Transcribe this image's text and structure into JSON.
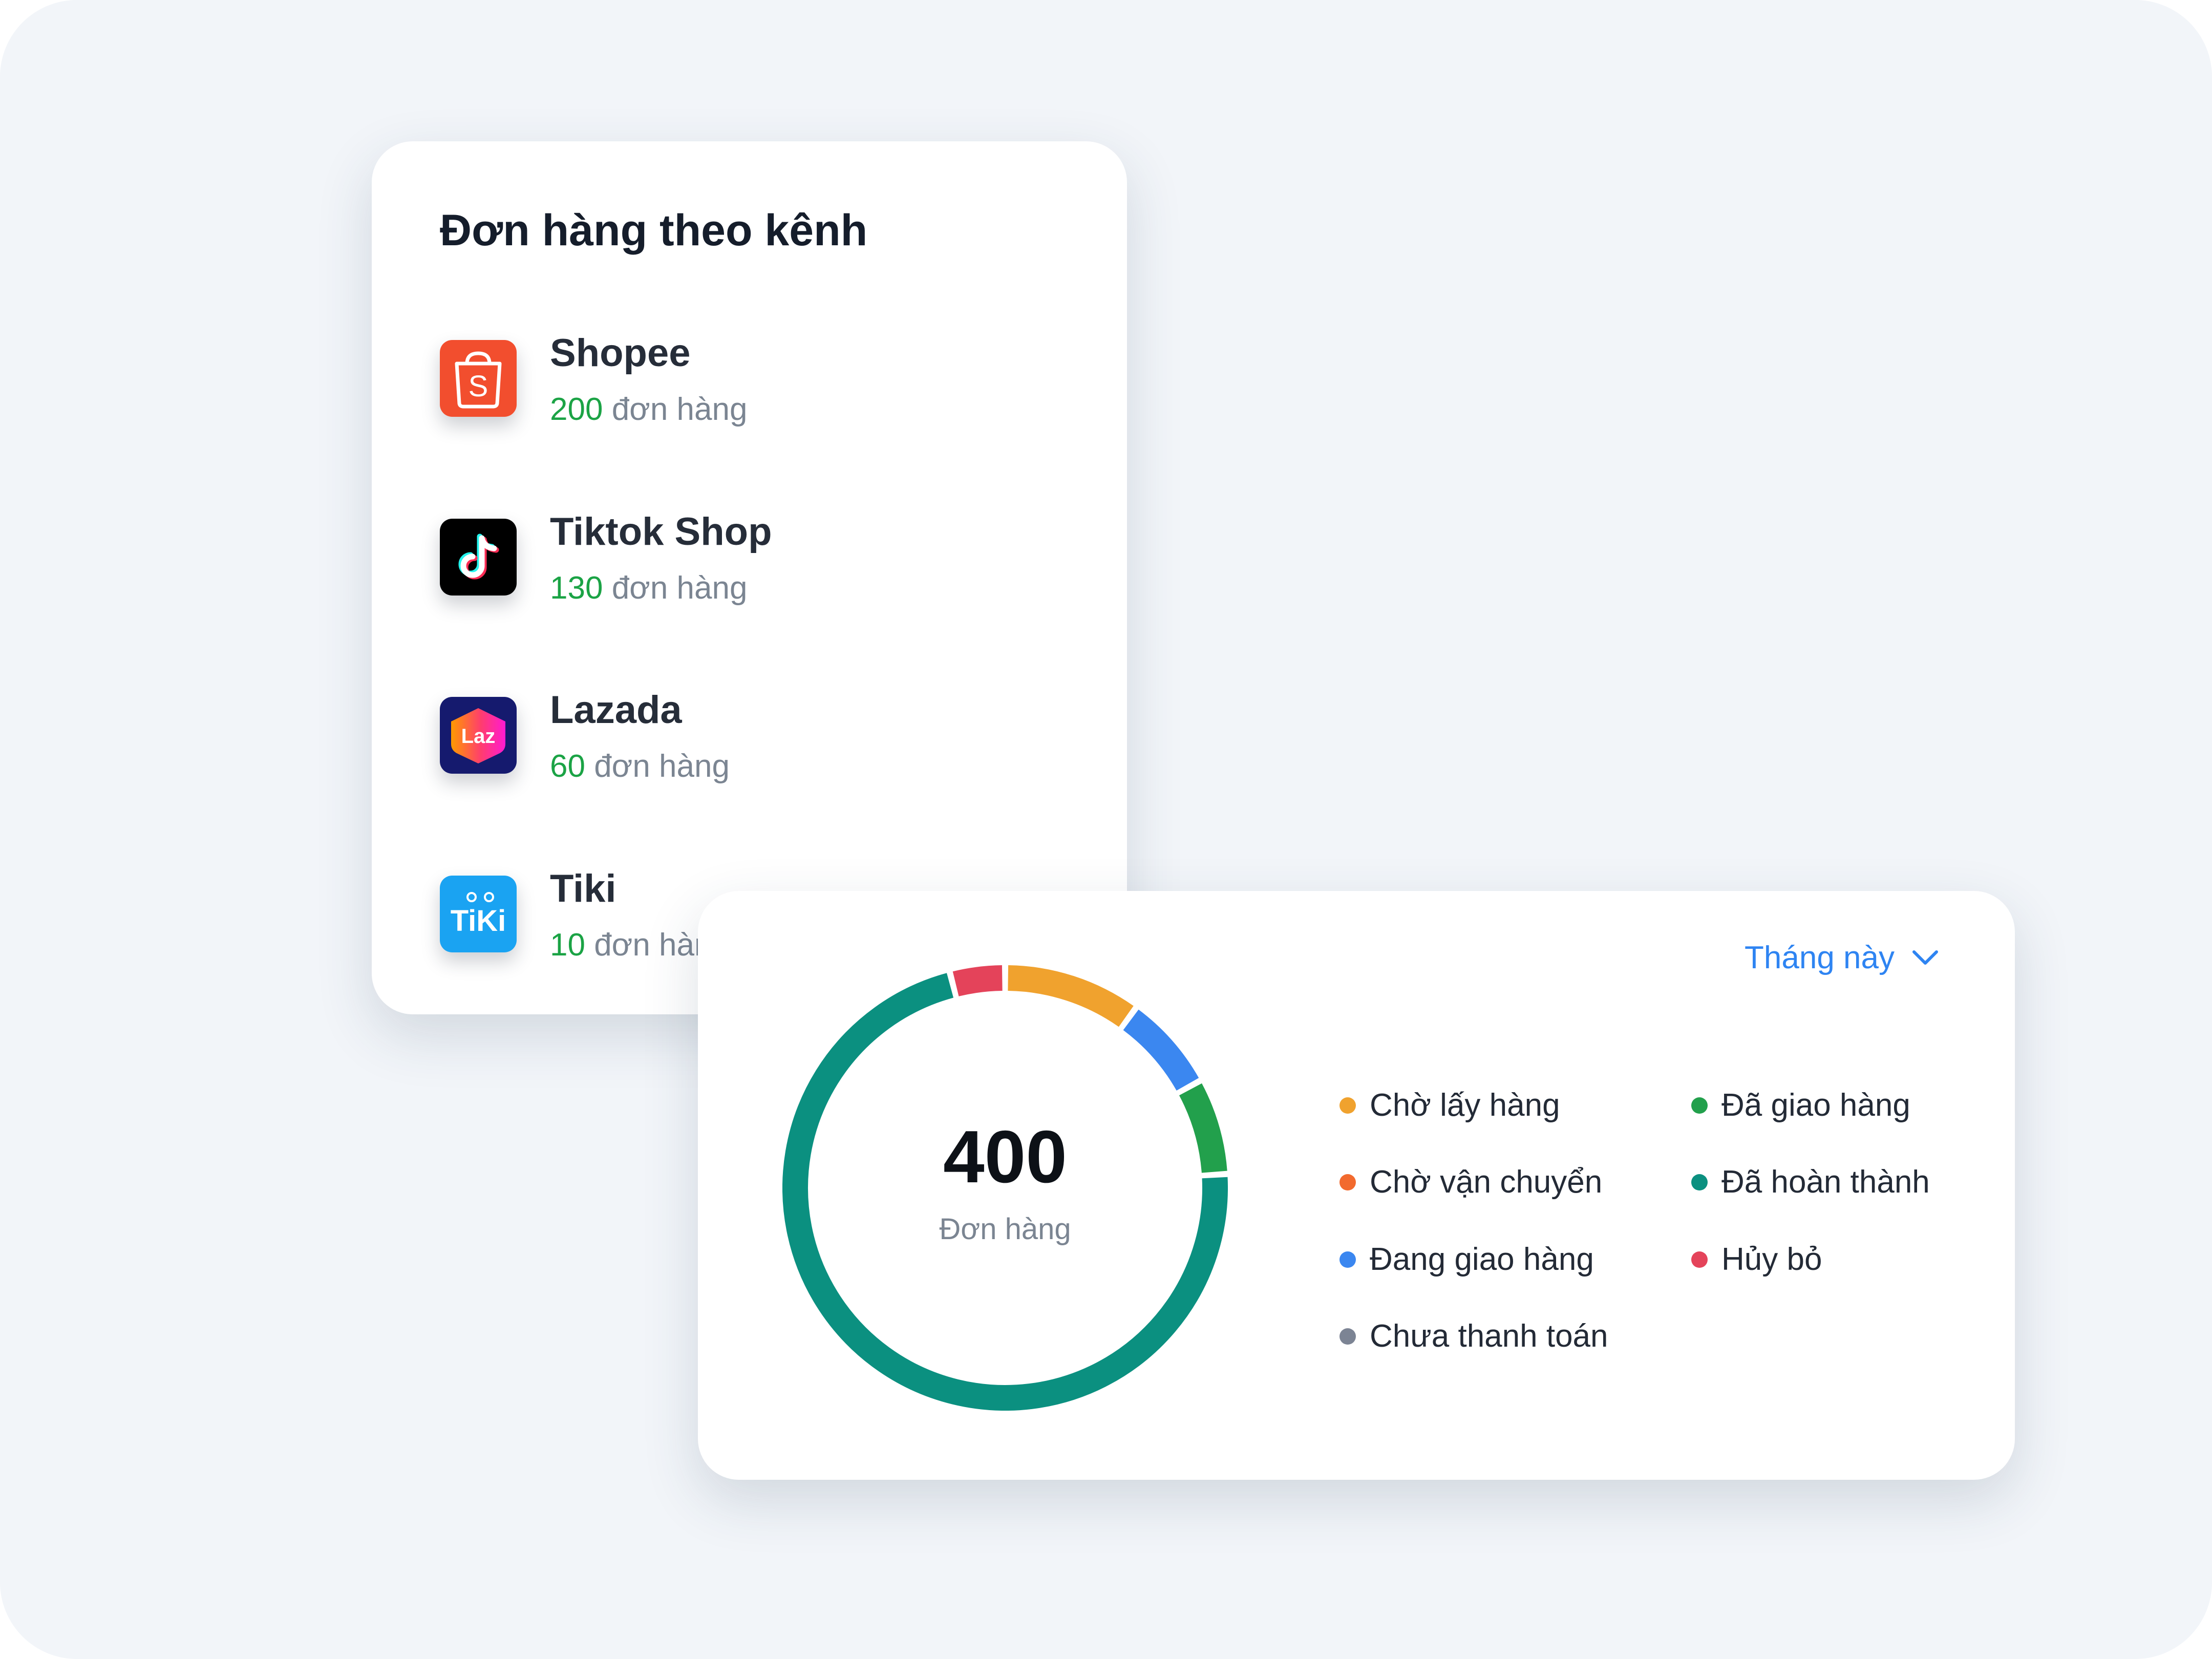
{
  "channels_card": {
    "title": "Đơn hàng theo kênh",
    "channels": [
      {
        "name": "Shopee",
        "count": "200",
        "unit": "đơn hàng",
        "icon": "shopee-icon",
        "letter": "S",
        "color": "#f24e2e"
      },
      {
        "name": "Tiktok Shop",
        "count": "130",
        "unit": "đơn hàng",
        "icon": "tiktok-icon",
        "color": "#000000"
      },
      {
        "name": "Lazada",
        "count": "60",
        "unit": "đơn hàng",
        "icon": "lazada-icon",
        "letter": "Laz",
        "color": "#151a6e"
      },
      {
        "name": "Tiki",
        "count": "10",
        "unit": "đơn hàng",
        "icon": "tiki-icon",
        "letter": "TiKi",
        "color": "#1aa3f2"
      }
    ]
  },
  "status_card": {
    "period_label": "Tháng này",
    "total": "400",
    "total_unit": "Đơn hàng",
    "legend": [
      {
        "label": "Chờ lấy hàng",
        "color": "#f0a22e"
      },
      {
        "label": "Chờ vận chuyển",
        "color": "#f26a2e"
      },
      {
        "label": "Đang giao hàng",
        "color": "#3b87f0"
      },
      {
        "label": "Chưa thanh toán",
        "color": "#7c8494"
      },
      {
        "label": "Đã giao hàng",
        "color": "#22a04c"
      },
      {
        "label": "Đã hoàn thành",
        "color": "#0b9080"
      },
      {
        "label": "Hủy bỏ",
        "color": "#e4435a"
      }
    ]
  },
  "chart_data": {
    "type": "donut",
    "title": "",
    "total": 400,
    "slices": [
      {
        "label": "Chờ lấy hàng",
        "fraction": 0.1,
        "color": "#f0a22e"
      },
      {
        "label": "Đang giao hàng",
        "fraction": 0.07,
        "color": "#3b87f0"
      },
      {
        "label": "Đã giao hàng",
        "fraction": 0.07,
        "color": "#22a04c"
      },
      {
        "label": "Đã hoàn thành",
        "fraction": 0.72,
        "color": "#0b9080"
      },
      {
        "label": "Hủy bỏ",
        "fraction": 0.04,
        "color": "#e4435a"
      }
    ]
  }
}
